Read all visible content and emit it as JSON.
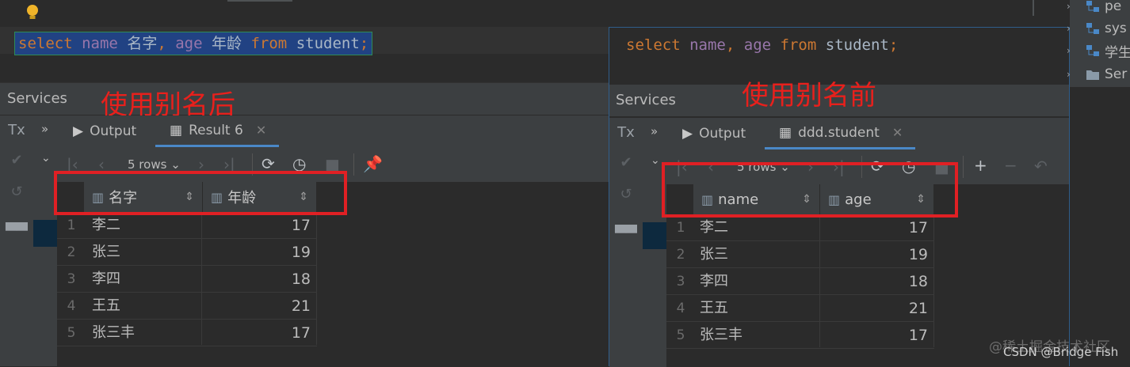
{
  "left": {
    "sql": {
      "kw_select": "select",
      "name": "name",
      "alias1": "名字",
      "comma": ",",
      "age": "age",
      "alias2": "年龄",
      "kw_from": "from",
      "table": "student",
      "semi": ";"
    },
    "services_title": "Services",
    "annotation": "使用别名后",
    "tabs": [
      {
        "label": "Output"
      },
      {
        "label": "Result 6"
      }
    ],
    "sidebar": {
      "tx": "Tx"
    },
    "rows_label": "5 rows",
    "columns": [
      "名字",
      "年龄"
    ],
    "rows": [
      {
        "n": "1",
        "name": "李二",
        "val": "17"
      },
      {
        "n": "2",
        "name": "张三",
        "val": "19"
      },
      {
        "n": "3",
        "name": "李四",
        "val": "18"
      },
      {
        "n": "4",
        "name": "王五",
        "val": "21"
      },
      {
        "n": "5",
        "name": "张三丰",
        "val": "17"
      }
    ]
  },
  "right": {
    "sql": {
      "kw_select": "select",
      "name": "name",
      "comma": ",",
      "age": "age",
      "kw_from": "from",
      "table": "student",
      "semi": ";"
    },
    "services_title": "Services",
    "annotation": "使用别名前",
    "tabs": [
      {
        "label": "Output"
      },
      {
        "label": "ddd.student"
      }
    ],
    "sidebar": {
      "tx": "Tx"
    },
    "rows_label": "5 rows",
    "columns": [
      "name",
      "age"
    ],
    "rows": [
      {
        "n": "1",
        "name": "李二",
        "val": "17"
      },
      {
        "n": "2",
        "name": "张三",
        "val": "19"
      },
      {
        "n": "3",
        "name": "李四",
        "val": "18"
      },
      {
        "n": "4",
        "name": "王五",
        "val": "21"
      },
      {
        "n": "5",
        "name": "张三丰",
        "val": "17"
      }
    ]
  },
  "project_tree": {
    "items": [
      {
        "label": "pe"
      },
      {
        "label": "sys"
      },
      {
        "label": "学生"
      },
      {
        "label": "Ser"
      }
    ]
  },
  "watermark": {
    "line1": "@稀土掘金技术社区",
    "line2": "CSDN @Bridge Fish"
  },
  "colors": {
    "accent_red": "#e02024",
    "selection_blue": "#214283",
    "keyword": "#cc7832",
    "field": "#9876aa"
  }
}
